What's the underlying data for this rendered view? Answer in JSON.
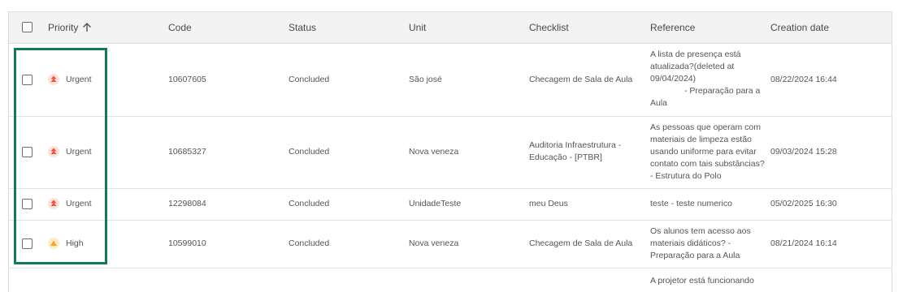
{
  "columns": {
    "priority": "Priority",
    "code": "Code",
    "status": "Status",
    "unit": "Unit",
    "checklist": "Checklist",
    "reference": "Reference",
    "creation_date": "Creation date"
  },
  "sort_icon": "arrow-up-icon",
  "priority_colors": {
    "urgent": "#e8543b",
    "high": "#f5a623"
  },
  "highlight_color": "#147a4f",
  "rows": [
    {
      "priority": "Urgent",
      "code": "10607605",
      "status": "Concluded",
      "unit": "São josé",
      "checklist": [
        "Checagem de Sala de Aula"
      ],
      "reference": [
        "A lista de presença está",
        "atualizada?(deleted at",
        "09/04/2024)",
        "- Preparação para a",
        "Aula"
      ],
      "creation_date": "08/22/2024 16:44"
    },
    {
      "priority": "Urgent",
      "code": "10685327",
      "status": "Concluded",
      "unit": "Nova veneza",
      "checklist": [
        "Auditoria Infraestrutura -",
        "Educação - [PTBR]"
      ],
      "reference": [
        "As pessoas que operam com",
        "materiais de limpeza estão",
        "usando uniforme para evitar",
        "contato com tais substâncias?",
        "- Estrutura do Polo"
      ],
      "creation_date": "09/03/2024 15:28"
    },
    {
      "priority": "Urgent",
      "code": "12298084",
      "status": "Concluded",
      "unit": "UnidadeTeste",
      "checklist": [
        "meu Deus"
      ],
      "reference": [
        "teste - teste numerico"
      ],
      "creation_date": "05/02/2025 16:30"
    },
    {
      "priority": "High",
      "code": "10599010",
      "status": "Concluded",
      "unit": "Nova veneza",
      "checklist": [
        "Checagem de Sala de Aula"
      ],
      "reference": [
        "Os alunos tem acesso aos",
        "materiais didáticos? -",
        "Preparação para a Aula"
      ],
      "creation_date": "08/21/2024 16:14"
    },
    {
      "priority": "",
      "code": "",
      "status": "",
      "unit": "",
      "checklist": [
        ""
      ],
      "reference": [
        "A projetor está funcionando"
      ],
      "creation_date": ""
    }
  ]
}
